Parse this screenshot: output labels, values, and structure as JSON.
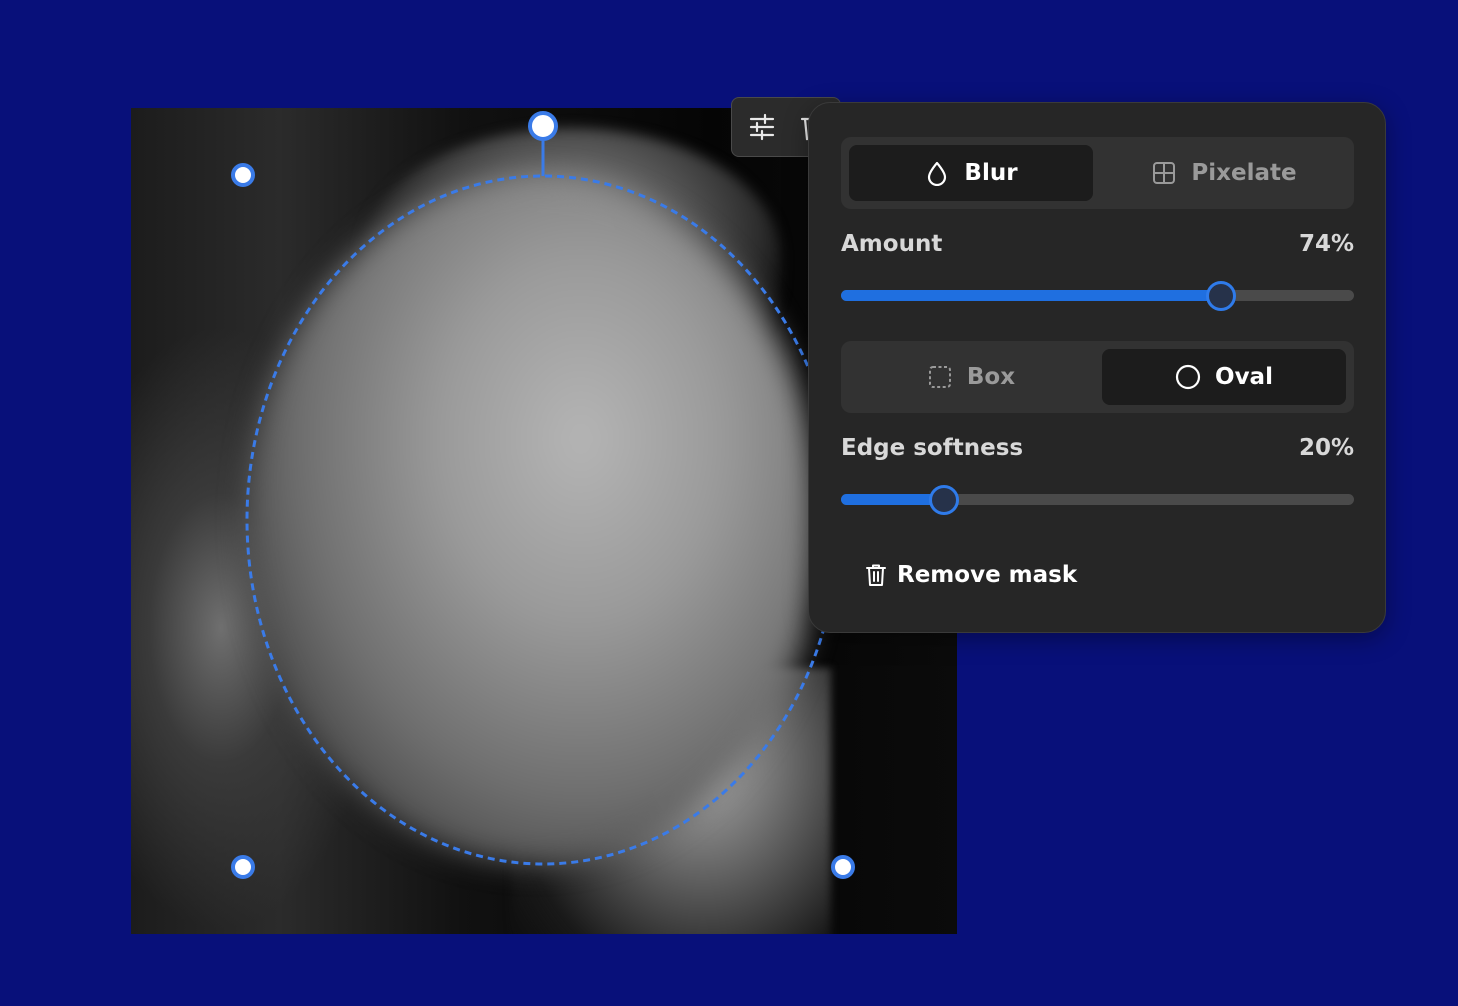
{
  "colors": {
    "background": "#08107a",
    "accent": "#1f6fe0",
    "handle": "#3a7be8",
    "panel": "#262626"
  },
  "photo": {
    "description_icon": "portrait-photo"
  },
  "mini_toolbar": {
    "adjust_icon": "sliders-icon",
    "delete_icon": "trash-icon"
  },
  "panel": {
    "effect": {
      "options": [
        {
          "label": "Blur",
          "icon": "droplet-icon",
          "active": true
        },
        {
          "label": "Pixelate",
          "icon": "grid-icon",
          "active": false
        }
      ]
    },
    "amount": {
      "label": "Amount",
      "value_text": "74%",
      "value": 74
    },
    "shape": {
      "options": [
        {
          "label": "Box",
          "icon": "dashed-square-icon",
          "active": false
        },
        {
          "label": "Oval",
          "icon": "circle-icon",
          "active": true
        }
      ]
    },
    "edge_softness": {
      "label": "Edge softness",
      "value_text": "20%",
      "value": 20
    },
    "remove_mask": {
      "label": "Remove mask",
      "icon": "trash-icon"
    }
  }
}
